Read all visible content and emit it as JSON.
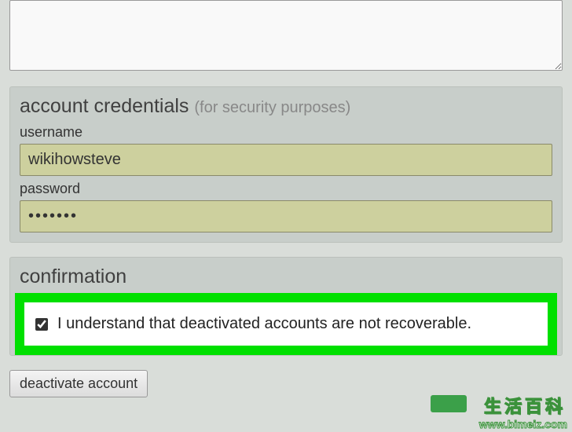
{
  "top_textarea": {
    "value": ""
  },
  "credentials": {
    "title": "account credentials",
    "subtitle": "(for security purposes)",
    "username_label": "username",
    "username_value": "wikihowsteve",
    "password_label": "password",
    "password_value": "•••••••"
  },
  "confirmation": {
    "title": "confirmation",
    "checkbox_checked": true,
    "text": "I understand that deactivated accounts are not recoverable."
  },
  "actions": {
    "deactivate_label": "deactivate account"
  },
  "watermark": {
    "cn_text": "生活百科",
    "url": "www.bimeiz.com"
  }
}
